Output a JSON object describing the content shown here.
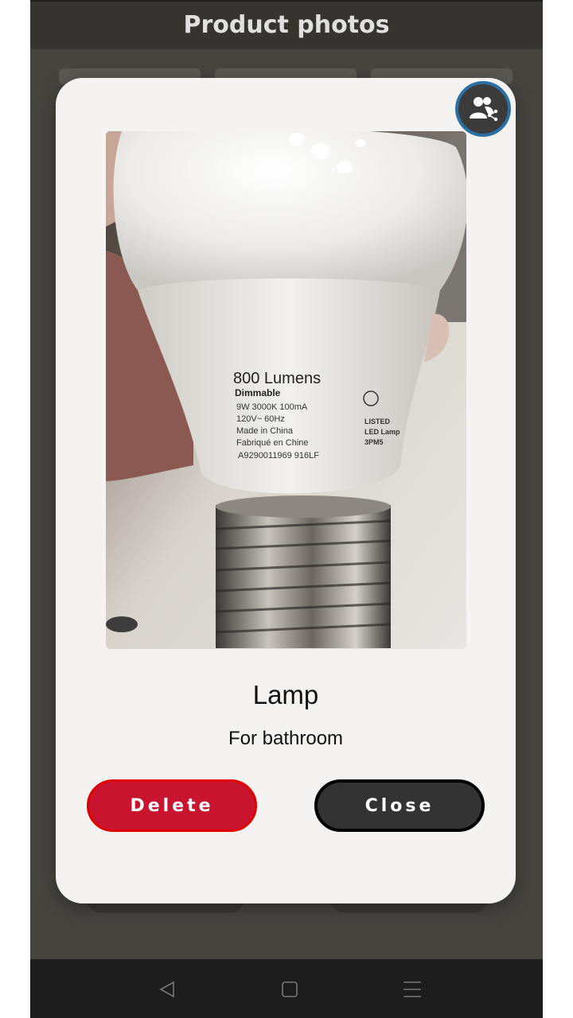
{
  "app": {
    "title": "Product photos"
  },
  "dialog": {
    "product_name": "Lamp",
    "product_description": "For bathroom",
    "delete_label": "Delete",
    "close_label": "Close",
    "share_icon": "people-share-icon",
    "photo_alt": "Photo of light bulb"
  },
  "photo_label": {
    "line1": "800 Lumens",
    "line2": "Dimmable",
    "line3": "9W 3000K 100mA",
    "line4": "120V~ 60Hz",
    "line5": "Made in China",
    "line6": "Fabriqué en Chine",
    "line7": "A9290011969 916LF",
    "cert1": "LISTED",
    "cert2": "LED Lamp",
    "cert3": "3PM5"
  },
  "nav": {
    "back_icon": "back-triangle-icon",
    "home_icon": "home-square-icon",
    "menu_icon": "menu-lines-icon"
  },
  "colors": {
    "delete": "#c8142f",
    "close": "#333333",
    "share_ring": "#2b6fa3"
  }
}
